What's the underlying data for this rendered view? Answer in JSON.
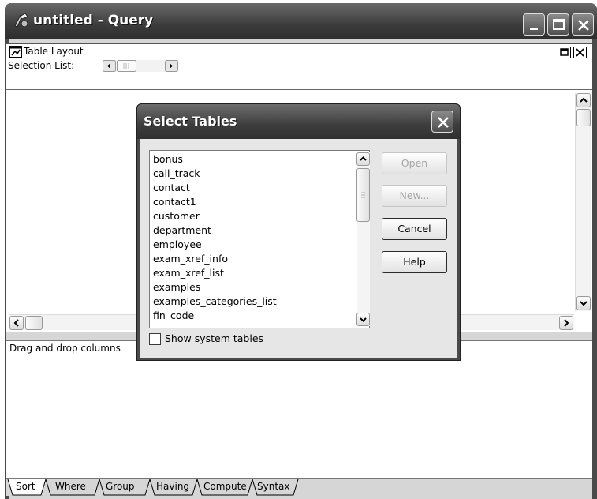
{
  "window": {
    "title": "untitled - Query",
    "app_icon": "query-painter-icon",
    "controls": [
      "minimize-icon",
      "maximize-icon",
      "close-icon"
    ]
  },
  "table_layout": {
    "title": "Table Layout",
    "selection_list_label": "Selection List:"
  },
  "lower_pane": {
    "hint": "Drag and drop columns"
  },
  "tabs": [
    {
      "label": "Sort"
    },
    {
      "label": "Where"
    },
    {
      "label": "Group"
    },
    {
      "label": "Having"
    },
    {
      "label": "Compute"
    },
    {
      "label": "Syntax"
    }
  ],
  "dialog": {
    "title": "Select Tables",
    "tables": [
      "bonus",
      "call_track",
      "contact",
      "contact1",
      "customer",
      "department",
      "employee",
      "exam_xref_info",
      "exam_xref_list",
      "examples",
      "examples_categories_list",
      "fin_code"
    ],
    "buttons": {
      "open": "Open",
      "new": "New...",
      "cancel": "Cancel",
      "help": "Help"
    },
    "show_system_tables": {
      "label": "Show system tables",
      "checked": false
    }
  }
}
